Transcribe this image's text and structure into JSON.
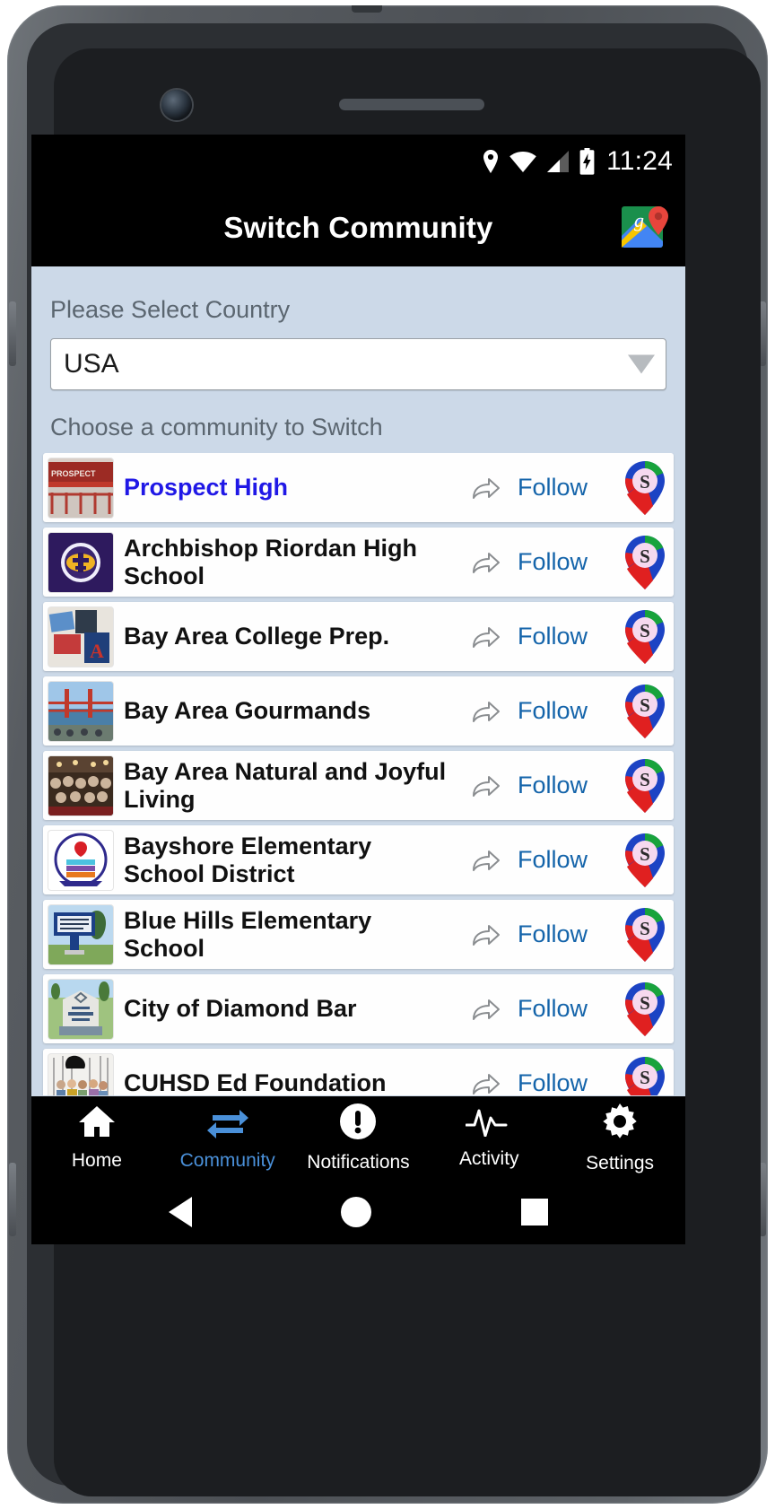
{
  "status_bar": {
    "time": "11:24",
    "icons": [
      "location-icon",
      "wifi-icon",
      "signal-icon",
      "battery-charging-icon"
    ]
  },
  "app_bar": {
    "title": "Switch Community",
    "action_icon": "google-maps-icon"
  },
  "form": {
    "country_label": "Please Select Country",
    "country_value": "USA",
    "country_caret_icon": "dropdown-caret-icon",
    "choose_label": "Choose a community to Switch"
  },
  "list": {
    "follow_label": "Follow",
    "share_icon": "share-arrow-icon",
    "pin_icon": "switch-pin-icon",
    "items": [
      {
        "name": "Prospect High",
        "active": true,
        "follow": "Follow",
        "thumb": "prospect-high-thumb"
      },
      {
        "name": "Archbishop Riordan High School",
        "active": false,
        "follow": "Follow",
        "thumb": "archbishop-riordan-thumb"
      },
      {
        "name": "Bay Area College Prep.",
        "active": false,
        "follow": "Follow",
        "thumb": "bay-area-college-prep-thumb"
      },
      {
        "name": "Bay Area Gourmands",
        "active": false,
        "follow": "Follow",
        "thumb": "bay-area-gourmands-thumb"
      },
      {
        "name": "Bay Area Natural and Joyful Living",
        "active": false,
        "follow": "Follow",
        "thumb": "bay-area-natural-thumb"
      },
      {
        "name": "Bayshore Elementary School District",
        "active": false,
        "follow": "Follow",
        "thumb": "bayshore-elementary-thumb"
      },
      {
        "name": "Blue Hills Elementary School",
        "active": false,
        "follow": "Follow",
        "thumb": "blue-hills-elementary-thumb"
      },
      {
        "name": "City of Diamond Bar",
        "active": false,
        "follow": "Follow",
        "thumb": "city-of-diamond-bar-thumb"
      },
      {
        "name": "CUHSD Ed Foundation",
        "active": false,
        "follow": "Follow",
        "thumb": "cuhsd-ed-foundation-thumb"
      }
    ]
  },
  "tab_bar": {
    "tabs": [
      {
        "label": "Home",
        "icon": "home-icon",
        "selected": false
      },
      {
        "label": "Community",
        "icon": "switch-arrows-icon",
        "selected": true
      },
      {
        "label": "Notifications",
        "icon": "alert-circle-icon",
        "selected": false
      },
      {
        "label": "Activity",
        "icon": "pulse-icon",
        "selected": false
      },
      {
        "label": "Settings",
        "icon": "gear-icon",
        "selected": false
      }
    ]
  },
  "nav_bar": {
    "back_icon": "back-triangle-icon",
    "home_icon": "home-circle-icon",
    "recents_icon": "recents-square-icon"
  },
  "colors": {
    "accent_blue": "#1464aa",
    "active_name": "#2018e6",
    "page_bg": "#ccd9e8",
    "bar_bg": "#000000",
    "tab_selected": "#4a90d9"
  }
}
